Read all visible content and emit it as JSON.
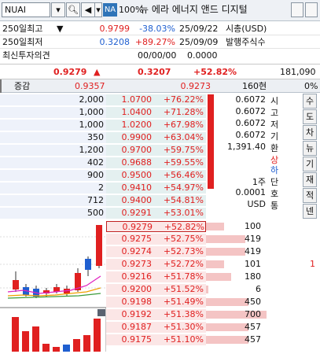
{
  "toolbar": {
    "symbol": "NUAI",
    "zoom": "100%",
    "na": "NA",
    "name": "뉴 에라 에너지 앤드 디지털"
  },
  "info": {
    "r1": {
      "label": "250일최고",
      "price": "0.9799",
      "rate": "-38.03%",
      "date": "25/09/22",
      "mlabel": "시총(USD)"
    },
    "r2": {
      "label": "250일최저",
      "price": "0.3208",
      "rate": "+89.27%",
      "date": "25/09/09",
      "mlabel": "발행주식수"
    },
    "r3": {
      "label": "최신투자의견",
      "date": "00/00/00",
      "val": "0.0000"
    }
  },
  "pricebar": {
    "last": "0.9279",
    "arrow": "▲",
    "change": "0.3207",
    "rate": "+52.82%",
    "volume": "181,090"
  },
  "header": {
    "label": "증감",
    "p1": "0.9357",
    "p2": "0.9273",
    "ticks": "160현",
    "pct": "0%"
  },
  "asks": [
    {
      "vol": "2,000",
      "price": "1.0700",
      "rate": "+76.22%",
      "bar": 0.22
    },
    {
      "vol": "1,000",
      "price": "1.0400",
      "rate": "+71.28%",
      "bar": 0.11
    },
    {
      "vol": "1,000",
      "price": "1.0200",
      "rate": "+67.98%",
      "bar": 0.11
    },
    {
      "vol": "350",
      "price": "0.9900",
      "rate": "+63.04%",
      "bar": 0.05
    },
    {
      "vol": "1,200",
      "price": "0.9700",
      "rate": "+59.75%",
      "bar": 0.13
    },
    {
      "vol": "402",
      "price": "0.9688",
      "rate": "+59.55%",
      "bar": 0.05
    },
    {
      "vol": "900",
      "price": "0.9500",
      "rate": "+56.46%",
      "bar": 0.1
    },
    {
      "vol": "2",
      "price": "0.9410",
      "rate": "+54.97%",
      "bar": 0.0
    },
    {
      "vol": "712",
      "price": "0.9400",
      "rate": "+54.81%",
      "bar": 0.08
    },
    {
      "vol": "500",
      "price": "0.9291",
      "rate": "+53.01%",
      "bar": 0.06
    }
  ],
  "bids": [
    {
      "price": "0.9279",
      "rate": "+52.82%",
      "vol": "100",
      "bar": 0.25
    },
    {
      "price": "0.9275",
      "rate": "+52.75%",
      "vol": "419",
      "bar": 0.55
    },
    {
      "price": "0.9274",
      "rate": "+52.73%",
      "vol": "419",
      "bar": 0.55
    },
    {
      "price": "0.9273",
      "rate": "+52.72%",
      "vol": "101",
      "bar": 0.25,
      "extra": "1"
    },
    {
      "price": "0.9216",
      "rate": "+51.78%",
      "vol": "180",
      "bar": 0.35
    },
    {
      "price": "0.9200",
      "rate": "+51.52%",
      "vol": "6",
      "bar": 0.03
    },
    {
      "price": "0.9198",
      "rate": "+51.49%",
      "vol": "450",
      "bar": 0.6
    },
    {
      "price": "0.9192",
      "rate": "+51.38%",
      "vol": "700",
      "bar": 0.85
    },
    {
      "price": "0.9187",
      "rate": "+51.30%",
      "vol": "457",
      "bar": 0.6
    },
    {
      "price": "0.9175",
      "rate": "+51.10%",
      "vol": "457",
      "bar": 0.6
    }
  ],
  "stats": {
    "rows": [
      {
        "v": "0.6072",
        "k": "시"
      },
      {
        "v": "0.6072",
        "k": "고"
      },
      {
        "v": "0.6072",
        "k": "저"
      },
      {
        "v": "0.6072",
        "k": "기"
      },
      {
        "v": "1,391.40",
        "k": "환"
      }
    ],
    "updown": [
      "상",
      "하"
    ],
    "rows2": [
      {
        "v": "1주",
        "k": "단"
      },
      {
        "v": "0.0001",
        "k": "호"
      },
      {
        "v": "USD",
        "k": "통"
      }
    ]
  },
  "side_buttons": [
    "수",
    "도",
    "차",
    "뉴",
    "기",
    "재",
    "적",
    "넨"
  ],
  "colors": {
    "up": "#e02020",
    "down": "#1f5fd0",
    "askbg": "#e4f0f0",
    "bidbg": "#fbe6e6"
  }
}
